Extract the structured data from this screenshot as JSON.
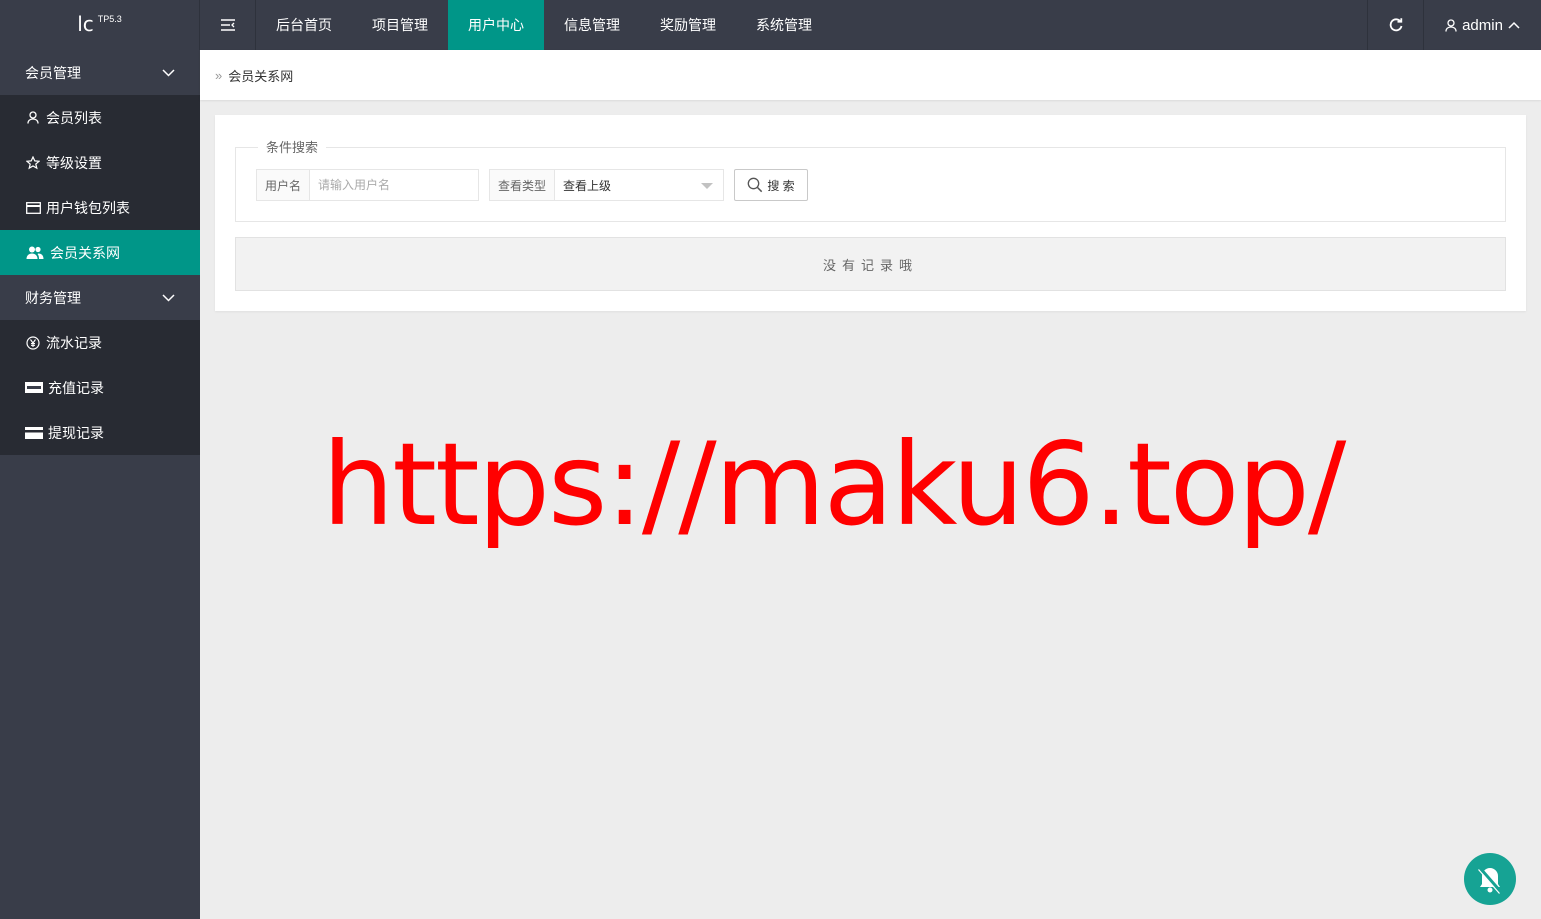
{
  "app": {
    "logo_text": "lc",
    "version": "TP5.3"
  },
  "header": {
    "nav": [
      {
        "label": "后台首页",
        "active": false
      },
      {
        "label": "项目管理",
        "active": false
      },
      {
        "label": "用户中心",
        "active": true
      },
      {
        "label": "信息管理",
        "active": false
      },
      {
        "label": "奖励管理",
        "active": false
      },
      {
        "label": "系统管理",
        "active": false
      }
    ],
    "user_name": "admin"
  },
  "sidebar": {
    "group1": {
      "title": "会员管理"
    },
    "group1_items": [
      {
        "label": "会员列表",
        "icon": "user-icon"
      },
      {
        "label": "等级设置",
        "icon": "star-icon"
      },
      {
        "label": "用户钱包列表",
        "icon": "card-icon"
      },
      {
        "label": "会员关系网",
        "icon": "users-icon",
        "active": true
      }
    ],
    "group2": {
      "title": "财务管理"
    },
    "group2_items": [
      {
        "label": "流水记录",
        "icon": "yen-icon"
      },
      {
        "label": "充值记录",
        "icon": "paypal-icon"
      },
      {
        "label": "提现记录",
        "icon": "card-icon"
      }
    ]
  },
  "breadcrumb": {
    "separator": "»",
    "current": "会员关系网"
  },
  "search": {
    "legend": "条件搜索",
    "username_label": "用户名",
    "username_placeholder": "请输入用户名",
    "username_value": "",
    "type_label": "查看类型",
    "type_value": "查看上级",
    "button_label": "搜 索"
  },
  "table": {
    "empty_text": "没有记录哦"
  },
  "watermark": "https://maku6.top/",
  "colors": {
    "accent": "#009688",
    "dark": "#393d49",
    "darker": "#282b33",
    "watermark": "#ff0000"
  }
}
